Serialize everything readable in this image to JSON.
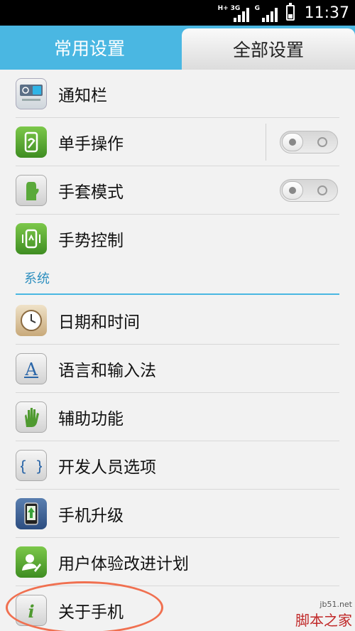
{
  "status_bar": {
    "network1": "H+",
    "network1_sub": "3G",
    "network2": "G",
    "time": "11:37"
  },
  "tabs": {
    "common": "常用设置",
    "all": "全部设置"
  },
  "items_top": [
    {
      "label": "通知栏",
      "icon": "notification-bar-icon"
    },
    {
      "label": "单手操作",
      "icon": "one-hand-icon",
      "toggle": false
    },
    {
      "label": "手套模式",
      "icon": "glove-icon",
      "toggle": false
    },
    {
      "label": "手势控制",
      "icon": "gesture-icon"
    }
  ],
  "section": {
    "title": "系统"
  },
  "items_system": [
    {
      "label": "日期和时间",
      "icon": "clock-icon"
    },
    {
      "label": "语言和输入法",
      "icon": "language-icon"
    },
    {
      "label": "辅助功能",
      "icon": "accessibility-hand-icon"
    },
    {
      "label": "开发人员选项",
      "icon": "developer-braces-icon"
    },
    {
      "label": "手机升级",
      "icon": "phone-upgrade-icon"
    },
    {
      "label": "用户体验改进计划",
      "icon": "user-experience-icon"
    },
    {
      "label": "关于手机",
      "icon": "info-icon"
    }
  ],
  "watermark": {
    "site": "jb51.net",
    "name": "脚本之家"
  }
}
